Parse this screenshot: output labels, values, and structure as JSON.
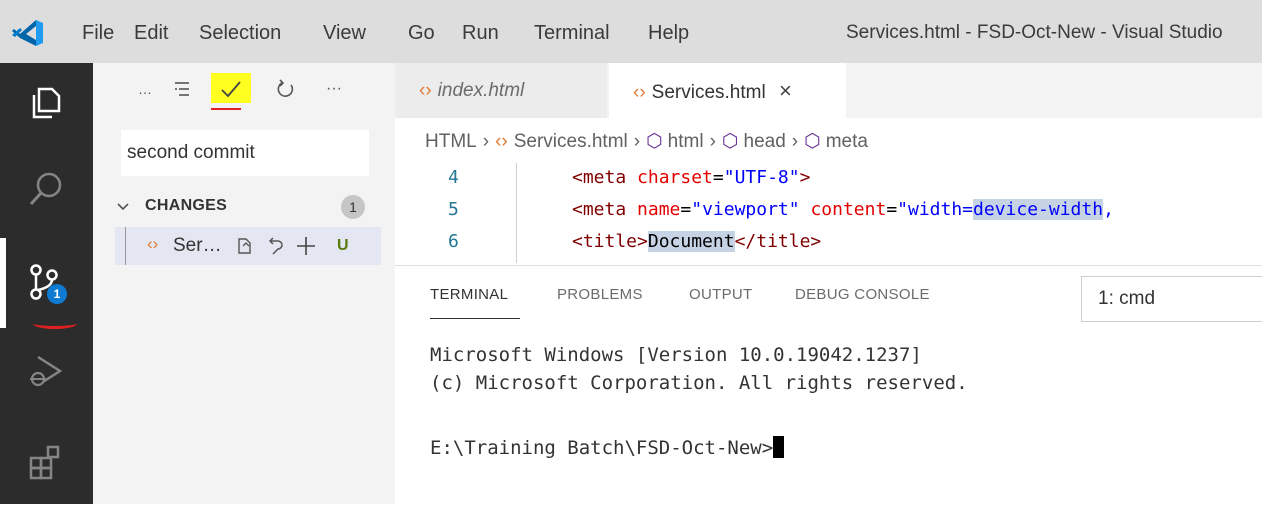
{
  "titlebar": {
    "menu": [
      "File",
      "Edit",
      "Selection",
      "View",
      "Go",
      "Run",
      "Terminal",
      "Help"
    ],
    "window_title": "Services.html - FSD-Oct-New - Visual Studio"
  },
  "activity_bar": {
    "items": [
      "explorer-icon",
      "search-icon",
      "source-control-icon",
      "run-debug-icon",
      "extensions-icon"
    ],
    "source_control_badge": "1",
    "badge_color": "#0e7ad1"
  },
  "sidebar": {
    "actions": [
      "…",
      "view-as-list-icon",
      "commit-check-icon",
      "refresh-icon",
      "more-icon"
    ],
    "more_label": "…",
    "overflow_label": "···",
    "commit_message": "second commit",
    "changes_label": "CHANGES",
    "changes_count": "1",
    "file": {
      "name": "Ser…",
      "status": "U",
      "status_color": "#587c0c"
    }
  },
  "tabs": [
    {
      "label": "index.html",
      "italic": true
    },
    {
      "label": "Services.html",
      "close": "×",
      "active": true
    }
  ],
  "breadcrumb": [
    "HTML",
    "Services.html",
    "html",
    "head",
    "meta"
  ],
  "code": {
    "lines": [
      {
        "n": "4"
      },
      {
        "n": "5"
      },
      {
        "n": "6"
      }
    ],
    "l4": {
      "open": "<meta ",
      "attr": "charset",
      "eq": "=",
      "val": "\"UTF-8\"",
      "close": ">"
    },
    "l5": {
      "open": "<meta ",
      "attr1": "name",
      "eq1": "=",
      "val1": "\"viewport\"",
      "attr2": "content",
      "eq2": "=",
      "val2a": "\"width=",
      "val2b": "device-width",
      "tail": ","
    },
    "l6": {
      "open": "<title>",
      "text": "Document",
      "close": "</title>"
    }
  },
  "panel": {
    "tabs": [
      "TERMINAL",
      "PROBLEMS",
      "OUTPUT",
      "DEBUG CONSOLE"
    ],
    "terminal_select": "1: cmd",
    "terminal_lines": [
      "Microsoft Windows [Version 10.0.19042.1237]",
      "(c) Microsoft Corporation. All rights reserved.",
      "E:\\Training Batch\\FSD-Oct-New>"
    ]
  }
}
